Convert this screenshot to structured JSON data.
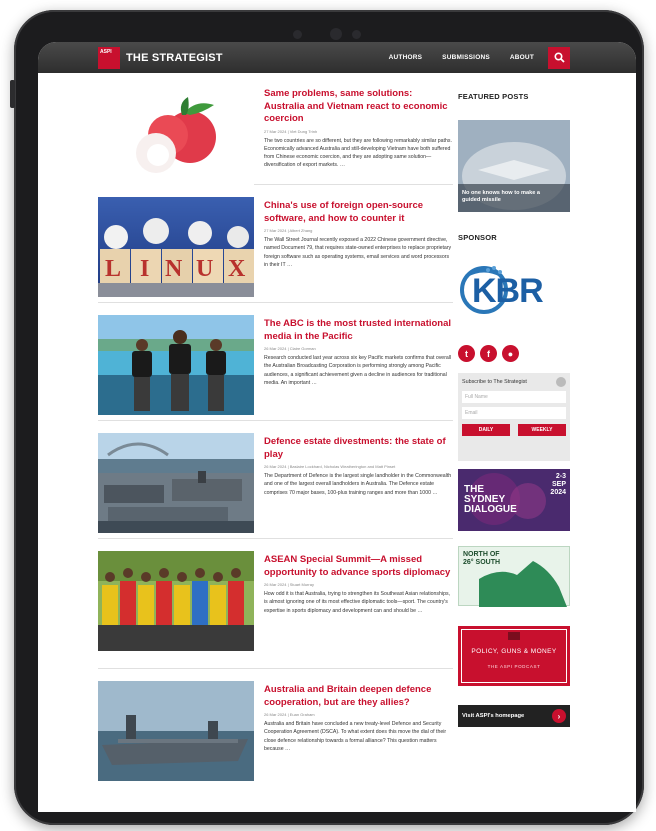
{
  "header": {
    "logo_text": "ASPI",
    "site_name": "THE STRATEGIST",
    "nav": [
      "AUTHORS",
      "SUBMISSIONS",
      "ABOUT"
    ]
  },
  "articles": [
    {
      "title": "Same problems, same solutions: Australia and Vietnam react to economic coercion",
      "meta": "27 Mar 2024 | Viet Dung Trinh",
      "body": "The two countries are so different, but they are following remarkably similar paths. Economically advanced Australia and still-developing Vietnam have both suffered from Chinese economic coercion, and they are adopting same solution—diversification of export markets. …"
    },
    {
      "title": "China's use of foreign open-source software, and how to counter it",
      "meta": "27 Mar 2024 | Albert Zhang",
      "body": "The Wall Street Journal recently exposed a 2022 Chinese government directive, named Document 79, that requires state-owned enterprises to replace proprietary foreign software such as operating systems, email services and word processors in their IT …"
    },
    {
      "title": "The ABC is the most trusted international media in the Pacific",
      "meta": "26 Mar 2024 | Claire Gorman",
      "body": "Research conducted last year across six key Pacific markets confirms that overall the Australian Broadcasting Corporation is performing strongly among Pacific audiences, a significant achievement given a decline in audiences for traditional media. An important …"
    },
    {
      "title": "Defence estate divestments: the state of play",
      "meta": "26 Mar 2024 | Baslaire Lockhard, Nicholas Weatherington and Matt Pinset",
      "body": "The Department of Defence is the largest single landholder in the Commonwealth and one of the largest overall landholders in Australia. The Defence estate comprises 70 major bases, 100-plus training ranges and more than 1000 …"
    },
    {
      "title": "ASEAN Special Summit—A missed opportunity to advance sports diplomacy",
      "meta": "26 Mar 2024 | Stuart Murray",
      "body": "How odd it is that Australia, trying to strengthen its Southeast Asian relationships, is almost ignoring one of its most effective diplomatic tools—sport. The country's expertise in sports diplomacy and development can and should be …"
    },
    {
      "title": "Australia and Britain deepen defence cooperation, but are they allies?",
      "meta": "26 Mar 2024 | Euan Graham",
      "body": "Australia and Britain have concluded a new treaty-level Defence and Security Cooperation Agreement (DSCA). To what extent does this move the dial of their close defence relationship towards a formal alliance? This question matters because …"
    }
  ],
  "sidebar": {
    "featured_heading": "FEATURED POSTS",
    "featured_caption": "No one knows how to make a guided missile",
    "sponsor_heading": "SPONSOR",
    "sponsor_logo": "KBR",
    "social_icons": [
      "twitter-icon",
      "facebook-icon",
      "rss-icon"
    ],
    "subscribe_label": "Subscribe to The Strategist",
    "fullname_placeholder": "Full Name",
    "email_placeholder": "Email",
    "daily_label": "DAILY",
    "weekly_label": "WEEKLY",
    "dialogue": {
      "line1": "THE",
      "line2": "SYDNEY",
      "line3": "DIALOGUE",
      "date1": "2-3",
      "date2": "SEP",
      "date3": "2024"
    },
    "north_line1": "NORTH OF",
    "north_line2": "26° SOUTH",
    "podcast_title": "POLICY, GUNS & MONEY",
    "podcast_sub": "THE ASPI PODCAST",
    "visit_label": "Visit ASPI's homepage"
  },
  "colors": {
    "accent": "#c8102e",
    "topbar": "#3a3a3a"
  }
}
